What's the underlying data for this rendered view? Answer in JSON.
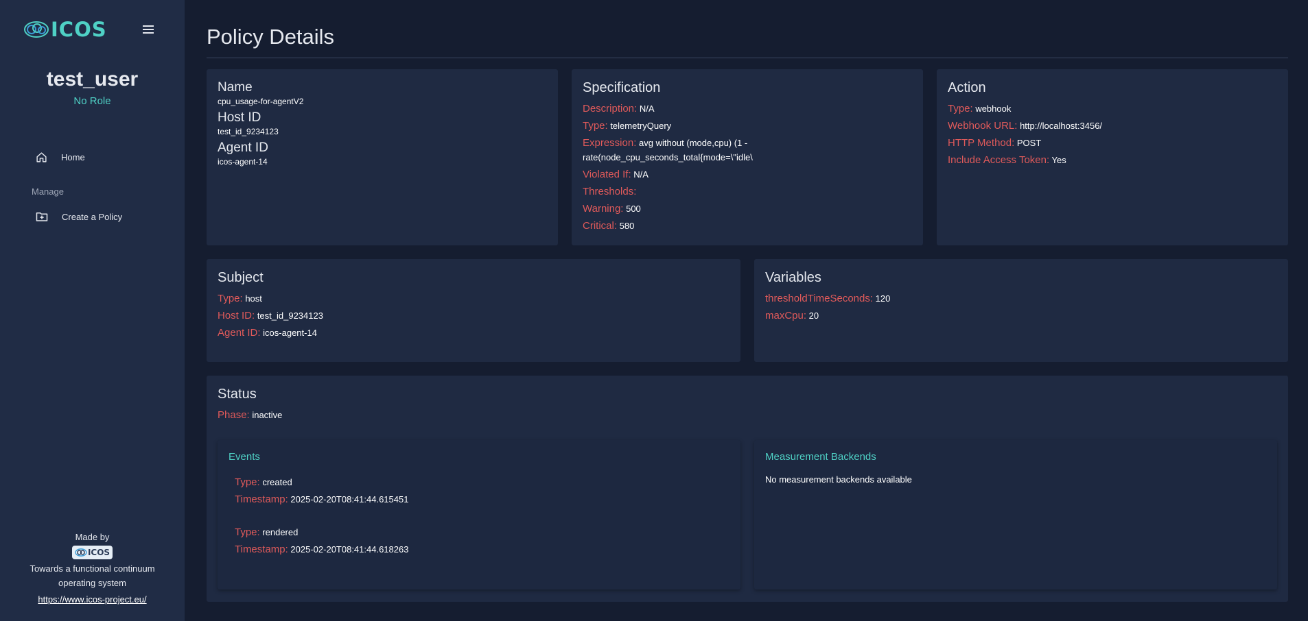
{
  "sidebar": {
    "logo_text": "ICOS",
    "username": "test_user",
    "role": "No Role",
    "nav": [
      {
        "label": "Home",
        "icon": "home-icon"
      },
      {
        "label": "Create a Policy",
        "icon": "folder-plus-icon"
      }
    ],
    "section_label": "Manage",
    "footer": {
      "made_by": "Made by",
      "logo_text": "ICOS",
      "tagline": "Towards a functional continuum operating system",
      "link": "https://www.icos-project.eu/"
    }
  },
  "page": {
    "title": "Policy Details"
  },
  "name_card": {
    "name_heading": "Name",
    "name_value": "cpu_usage-for-agentV2",
    "host_heading": "Host ID",
    "host_value": "test_id_9234123",
    "agent_heading": "Agent ID",
    "agent_value": "icos-agent-14"
  },
  "specification": {
    "heading": "Specification",
    "description_label": "Description:",
    "description_value": "N/A",
    "type_label": "Type:",
    "type_value": "telemetryQuery",
    "expression_label": "Expression:",
    "expression_value": "avg without (mode,cpu) (1 - rate(node_cpu_seconds_total{mode=\\\"idle\\",
    "violated_label": "Violated If:",
    "violated_value": "N/A",
    "thresholds_label": "Thresholds:",
    "warning_label": "Warning:",
    "warning_value": "500",
    "critical_label": "Critical:",
    "critical_value": "580"
  },
  "action": {
    "heading": "Action",
    "type_label": "Type:",
    "type_value": "webhook",
    "url_label": "Webhook URL:",
    "url_value": "http://localhost:3456/",
    "method_label": "HTTP Method:",
    "method_value": "POST",
    "token_label": "Include Access Token:",
    "token_value": "Yes"
  },
  "subject": {
    "heading": "Subject",
    "type_label": "Type:",
    "type_value": "host",
    "host_label": "Host ID:",
    "host_value": "test_id_9234123",
    "agent_label": "Agent ID:",
    "agent_value": "icos-agent-14"
  },
  "variables": {
    "heading": "Variables",
    "items": [
      {
        "label": "thresholdTimeSeconds:",
        "value": "120"
      },
      {
        "label": "maxCpu:",
        "value": "20"
      }
    ]
  },
  "status": {
    "heading": "Status",
    "phase_label": "Phase:",
    "phase_value": "inactive",
    "events": {
      "title": "Events",
      "items": [
        {
          "type_label": "Type:",
          "type_value": "created",
          "ts_label": "Timestamp:",
          "ts_value": "2025-02-20T08:41:44.615451"
        },
        {
          "type_label": "Type:",
          "type_value": "rendered",
          "ts_label": "Timestamp:",
          "ts_value": "2025-02-20T08:41:44.618263"
        }
      ]
    },
    "backends": {
      "title": "Measurement Backends",
      "empty_text": "No measurement backends available"
    }
  },
  "colors": {
    "background": "#151d30",
    "sidebar": "#202c45",
    "card": "#1f2a42",
    "accent_teal": "#4fd1c5",
    "label_red": "#e05a5a"
  }
}
